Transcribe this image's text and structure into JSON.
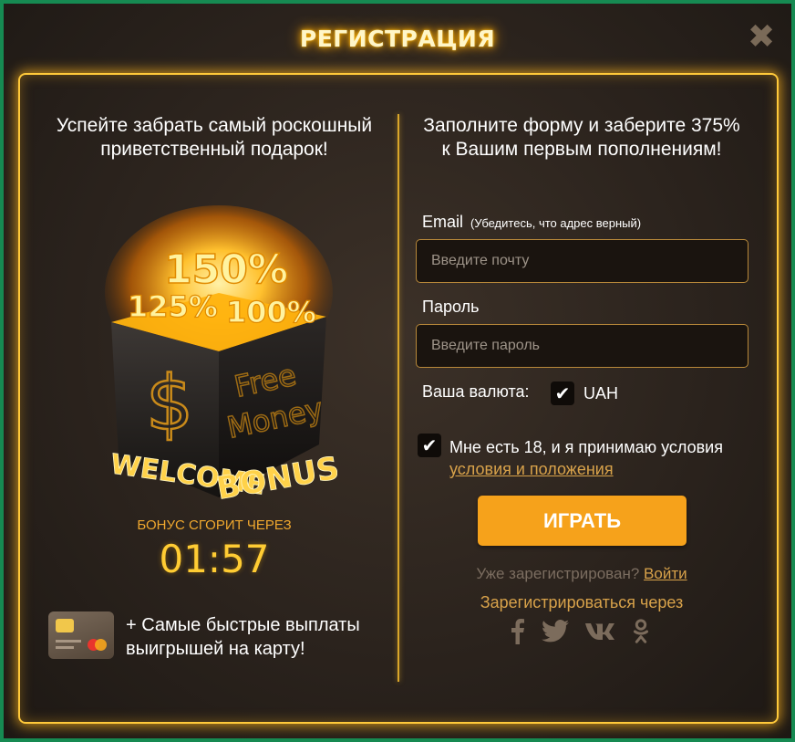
{
  "modal": {
    "title": "РЕГИСТРАЦИЯ",
    "close_symbol": "✖"
  },
  "left": {
    "heading": "Успейте забрать самый роскошный приветственный подарок!",
    "box": {
      "bonus_top": "150%",
      "bonus_left": "125%",
      "bonus_right": "100%",
      "dollar": "$",
      "side_line1": "Free",
      "side_line2": "Money",
      "welcome_word1": "WELCOME",
      "welcome_word2": "BONUS"
    },
    "timer_label": "БОНУС СГОРИТ ЧЕРЕЗ",
    "timer_value": "01:57",
    "card_text": "+ Самые быстрые выплаты выигрышей на карту!"
  },
  "right": {
    "heading": "Заполните форму и заберите 375% к Вашим первым пополнениям!",
    "email_label": "Email",
    "email_hint": "(Убедитесь, что адрес верный)",
    "email_placeholder": "Введите почту",
    "password_label": "Пароль",
    "password_placeholder": "Введите пароль",
    "currency_label": "Ваша валюта:",
    "currency_checked": true,
    "currency_value": "UAH",
    "age_checked": true,
    "age_text": "Мне есть 18, и я принимаю условия",
    "terms_link": "условия и положения",
    "play_button": "ИГРАТЬ",
    "already_registered": "Уже зарегистрирован?",
    "login_link": "Войти",
    "social_heading": "Зарегистрироваться через",
    "social_icons": [
      "facebook-icon",
      "twitter-icon",
      "vk-icon",
      "odnoklassniki-icon"
    ]
  },
  "colors": {
    "accent_orange": "#f6a21b",
    "gold_glow": "#ffc93a",
    "link_gold": "#d8a24a",
    "page_border_green": "#168a52",
    "background_dark": "#2b231d"
  }
}
